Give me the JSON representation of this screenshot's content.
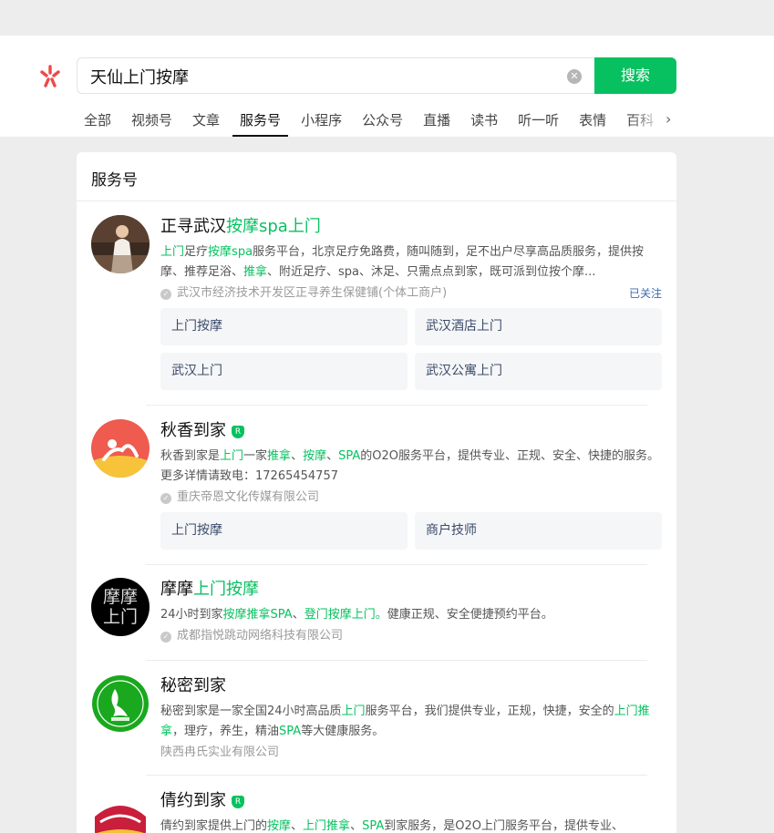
{
  "search": {
    "query": "天仙上门按摩",
    "button_label": "搜索"
  },
  "tabs": [
    "全部",
    "视频号",
    "文章",
    "服务号",
    "小程序",
    "公众号",
    "直播",
    "读书",
    "听一听",
    "表情",
    "百科"
  ],
  "active_tab": "服务号",
  "panel": {
    "title": "服务号"
  },
  "results": [
    {
      "name_plain": "正寻武汉",
      "name_hl": "按摩spa上门",
      "desc_parts": [
        {
          "t": "上门",
          "h": true
        },
        {
          "t": "足疗",
          "h": false
        },
        {
          "t": "按摩",
          "h": true
        },
        {
          "t": "spa",
          "h": true
        },
        {
          "t": "服务平台，北京足疗免路费，随叫随到，足不出户尽享高品质服务，提供按摩、推荐足浴、",
          "h": false
        },
        {
          "t": "推拿",
          "h": true
        },
        {
          "t": "、附近足疗、spa、沐足、只需点点到家，既可派到位按个摩...",
          "h": false
        }
      ],
      "company": "武汉市经济技术开发区正寻养生保健铺(个体工商户)",
      "followed": "已关注",
      "links": [
        "上门按摩",
        "武汉酒店上门",
        "武汉上门",
        "武汉公寓上门"
      ]
    },
    {
      "name_plain": "秋香到家",
      "name_hl": "",
      "verified": true,
      "desc_parts": [
        {
          "t": "秋香到家是",
          "h": false
        },
        {
          "t": "上门",
          "h": true
        },
        {
          "t": "一家",
          "h": false
        },
        {
          "t": "推拿",
          "h": true
        },
        {
          "t": "、",
          "h": false
        },
        {
          "t": "按摩",
          "h": true
        },
        {
          "t": "、",
          "h": false
        },
        {
          "t": "SPA",
          "h": true
        },
        {
          "t": "的O2O服务平台，提供专业、正规、安全、快捷的服务。 更多详情请致电：17265454757",
          "h": false
        }
      ],
      "company": "重庆帝恩文化传媒有限公司",
      "links": [
        "上门按摩",
        "商户技师"
      ]
    },
    {
      "name_plain": "摩摩",
      "name_hl": "上门按摩",
      "avatar_text": [
        "摩摩",
        "上门"
      ],
      "desc_parts": [
        {
          "t": "24小时到家",
          "h": false
        },
        {
          "t": "按摩推拿SPA",
          "h": true
        },
        {
          "t": "、",
          "h": false
        },
        {
          "t": "登门按摩上门。",
          "h": true
        },
        {
          "t": "健康正规、安全便捷预约平台。",
          "h": false
        }
      ],
      "company": "成都指悦跳动网络科技有限公司"
    },
    {
      "name_plain": "秘密到家",
      "name_hl": "",
      "desc_parts": [
        {
          "t": "秘密到家是一家全国24小时高品质",
          "h": false
        },
        {
          "t": "上门",
          "h": true
        },
        {
          "t": "服务平台，我们提供专业，正规，快捷，安全的",
          "h": false
        },
        {
          "t": "上门推拿",
          "h": true
        },
        {
          "t": "，理疗，养生，精油",
          "h": false
        },
        {
          "t": "SPA",
          "h": true
        },
        {
          "t": "等大健康服务。",
          "h": false
        }
      ],
      "company": "陕西冉氏实业有限公司"
    },
    {
      "name_plain": "倩约到家",
      "name_hl": "",
      "verified": true,
      "desc_parts": [
        {
          "t": "倩约到家提供上门的",
          "h": false
        },
        {
          "t": "按摩",
          "h": true
        },
        {
          "t": "、",
          "h": false
        },
        {
          "t": "上门推拿",
          "h": true
        },
        {
          "t": "、",
          "h": false
        },
        {
          "t": "SPA",
          "h": true
        },
        {
          "t": "到家服务，是O2O上门服务平台，提供专业、",
          "h": false
        }
      ]
    }
  ],
  "colors": {
    "accent": "#07c160",
    "link_blue": "#3c6bb0"
  }
}
